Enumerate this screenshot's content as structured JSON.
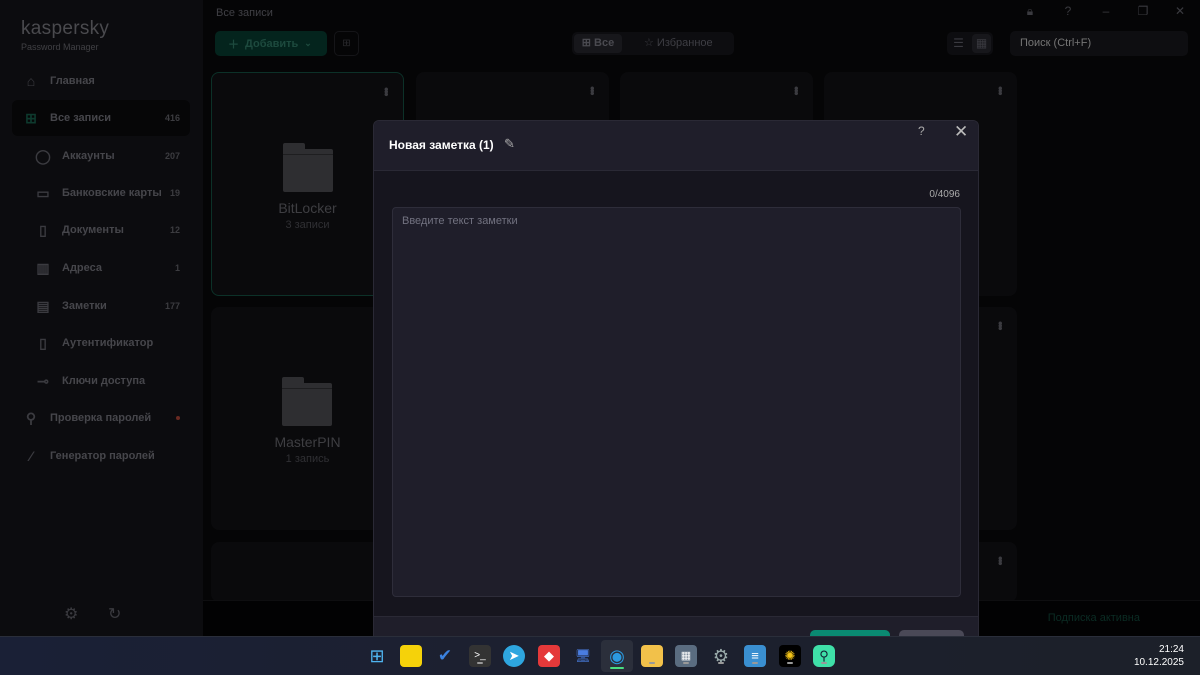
{
  "window": {
    "title": "Все записи"
  },
  "sidebar": {
    "logo": "kaspersky",
    "logo_sub": "Password Manager",
    "items": [
      {
        "label": "Главная",
        "icon": "home-icon",
        "count": null
      },
      {
        "label": "Все записи",
        "icon": "grid-icon",
        "count": "416",
        "selected": true
      },
      {
        "label": "Аккаунты",
        "icon": "user-icon",
        "count": "207"
      },
      {
        "label": "Банковские карты",
        "icon": "card-icon",
        "count": "19"
      },
      {
        "label": "Документы",
        "icon": "document-icon",
        "count": "12"
      },
      {
        "label": "Адреса",
        "icon": "building-icon",
        "count": "1"
      },
      {
        "label": "Заметки",
        "icon": "note-icon",
        "count": "177"
      },
      {
        "label": "Аутентификатор",
        "icon": "phone-icon",
        "count": null
      },
      {
        "label": "Ключи доступа",
        "icon": "key-icon",
        "count": null
      },
      {
        "label": "Проверка паролей",
        "icon": "password-check-icon",
        "alert_color": "#c0392b"
      },
      {
        "label": "Генератор паролей",
        "icon": "magic-wand-icon",
        "count": null
      }
    ]
  },
  "toolbar": {
    "add_label": "Добавить",
    "filter_all": "Все",
    "filter_favorites": "Избранное",
    "search_placeholder": "Поиск (Ctrl+F)"
  },
  "cards": [
    {
      "name": "BitLocker",
      "sub": "3 записи"
    },
    {
      "name": "MasterPIN",
      "sub": "1 запись"
    }
  ],
  "status": {
    "subscription": "Подписка активна"
  },
  "modal": {
    "title": "Новая заметка (1)",
    "help": "?",
    "close": "✕",
    "counter": "0/4096",
    "placeholder": "Введите текст заметки",
    "value": ""
  },
  "taskbar": {
    "time": "21:24",
    "date": "10.12.2025"
  },
  "colors": {
    "accent": "#0a8a72"
  }
}
